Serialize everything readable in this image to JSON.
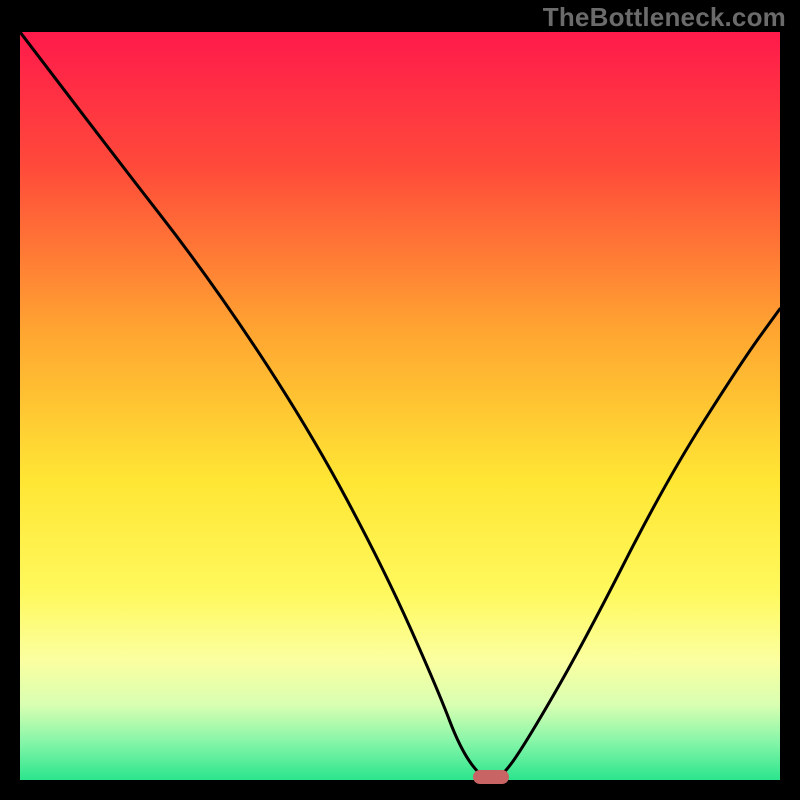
{
  "watermark": {
    "text": "TheBottleneck.com"
  },
  "chart_data": {
    "type": "line",
    "title": "",
    "xlabel": "",
    "ylabel": "",
    "xlim": [
      0,
      100
    ],
    "ylim": [
      0,
      100
    ],
    "grid": false,
    "legend": false,
    "series": [
      {
        "name": "bottleneck-curve",
        "x": [
          0,
          12,
          25,
          38,
          48,
          55,
          58,
          61,
          63,
          66,
          74,
          85,
          95,
          100
        ],
        "values": [
          100,
          84,
          67,
          47,
          28,
          12,
          4,
          0,
          0,
          4,
          18,
          40,
          56,
          63
        ]
      }
    ],
    "optimal_marker": {
      "x": 62,
      "y": 0
    },
    "background_gradient": {
      "stops": [
        {
          "offset": 0,
          "color": "#ff1a4b"
        },
        {
          "offset": 18,
          "color": "#ff4a3a"
        },
        {
          "offset": 40,
          "color": "#ffa531"
        },
        {
          "offset": 60,
          "color": "#ffe634"
        },
        {
          "offset": 75,
          "color": "#fff95e"
        },
        {
          "offset": 84,
          "color": "#fbffa0"
        },
        {
          "offset": 90,
          "color": "#d8ffb2"
        },
        {
          "offset": 95,
          "color": "#84f5a8"
        },
        {
          "offset": 100,
          "color": "#2be58d"
        }
      ]
    }
  }
}
